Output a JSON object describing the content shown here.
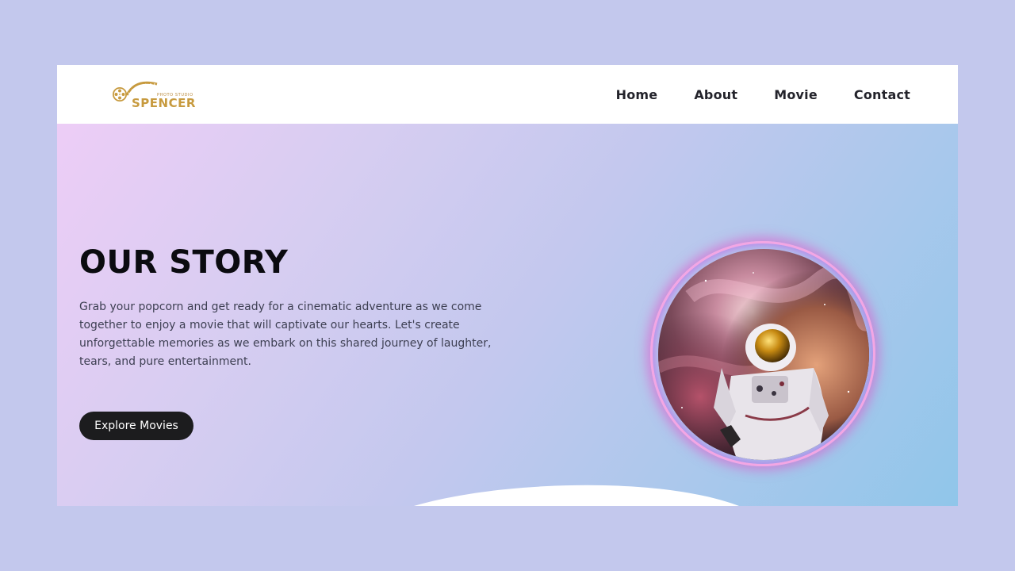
{
  "brand": {
    "name": "SPENCER",
    "tagline": "PHOTO STUDIO"
  },
  "nav": {
    "items": [
      {
        "label": "Home"
      },
      {
        "label": "About"
      },
      {
        "label": "Movie"
      },
      {
        "label": "Contact"
      }
    ]
  },
  "hero": {
    "title": "OUR STORY",
    "description": "Grab your popcorn and get ready for a cinematic adventure as we come together to enjoy a movie that will captivate our hearts. Let's create unforgettable memories as we embark on this shared journey of laughter, tears, and pure entertainment.",
    "cta_label": "Explore Movies",
    "image_subject": "astronaut-in-nebula"
  },
  "colors": {
    "page_background": "#c3c8ed",
    "brand_gold": "#c79a3e",
    "button_background": "#1c1c1e",
    "glow_ring": "#f3a6e4",
    "gradient_start": "#edcdf6",
    "gradient_end": "#90c6ea"
  }
}
